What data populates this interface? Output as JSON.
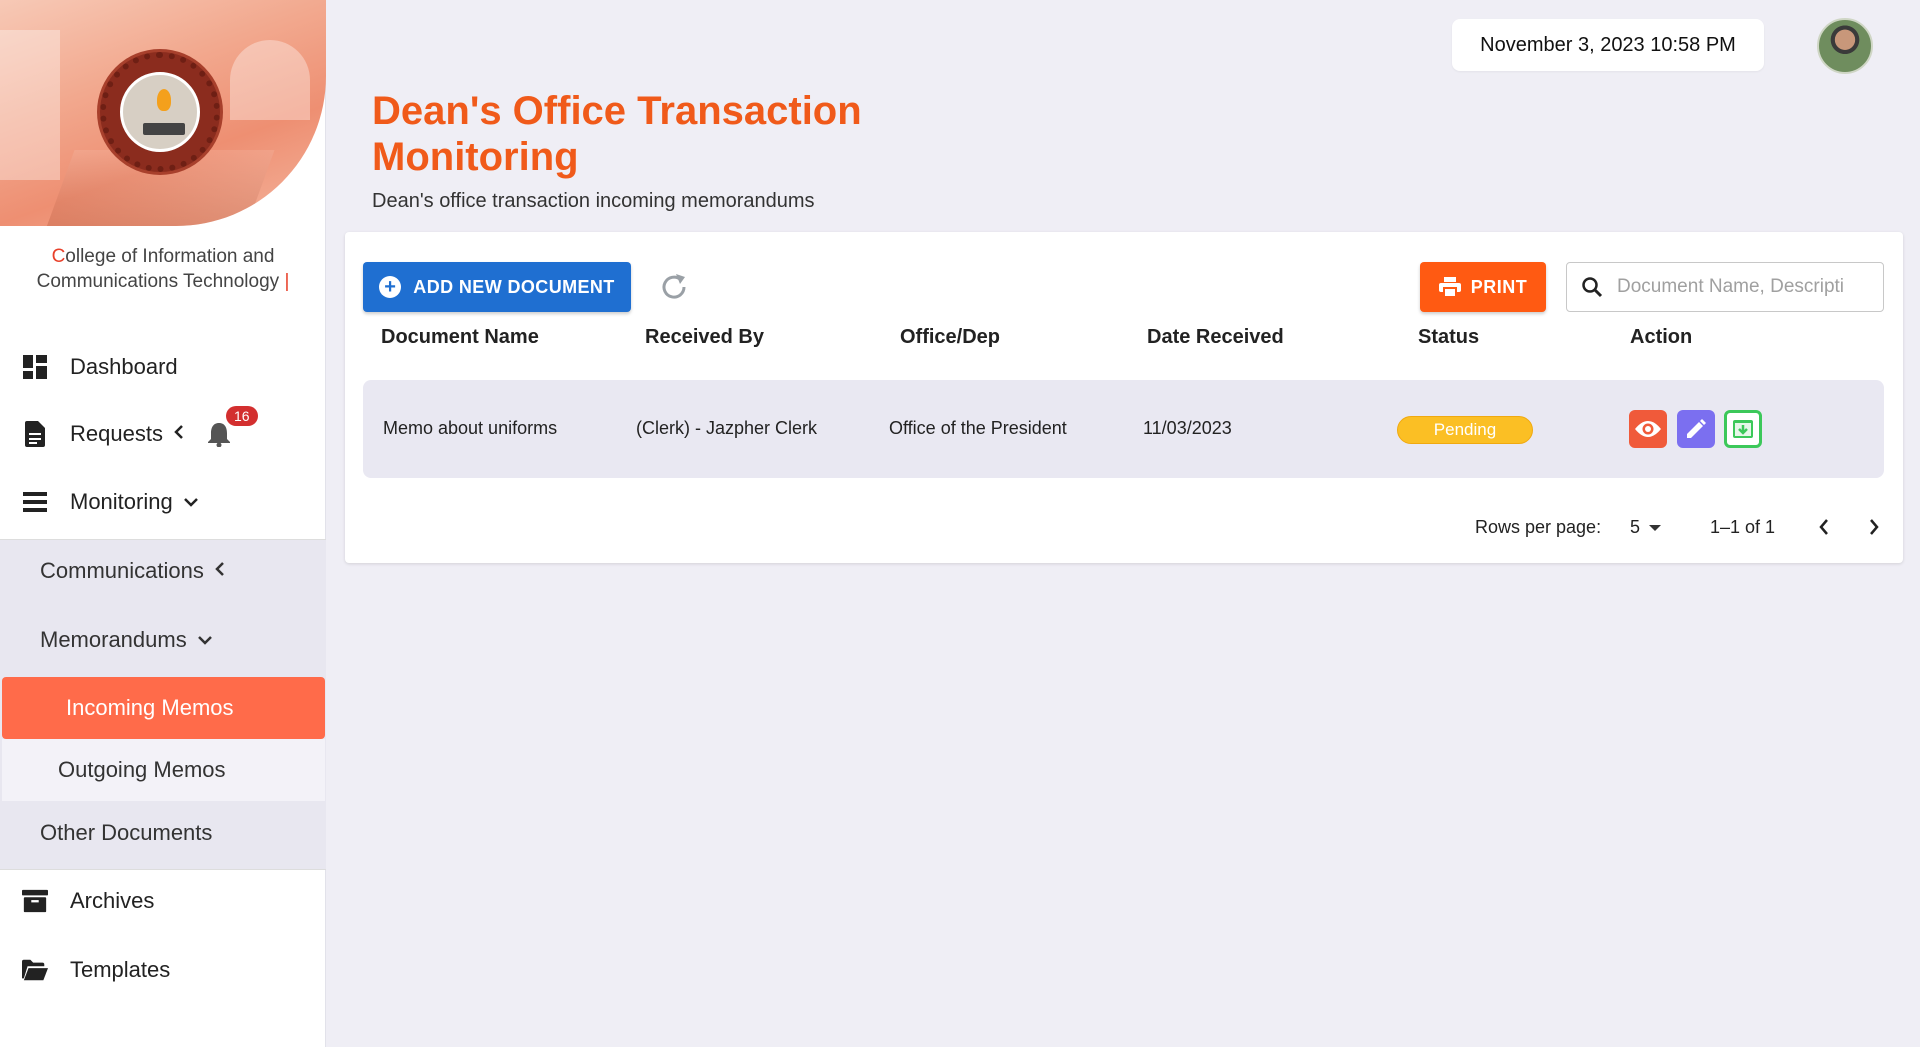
{
  "header": {
    "datetime": "November 3, 2023 10:58 PM",
    "title": "Dean's Office Transaction Monitoring",
    "subtitle": "Dean's office transaction incoming memorandums"
  },
  "sidebar": {
    "college_first_letter": "C",
    "college_rest_line1": "ollege of Information and",
    "college_line2": "Communications Technology",
    "college_bar": "|",
    "items": [
      {
        "label": "Dashboard",
        "icon": "dashboard-icon"
      },
      {
        "label": "Requests",
        "icon": "document-icon",
        "badge": "16"
      },
      {
        "label": "Monitoring",
        "icon": "list-icon"
      },
      {
        "label": "Archives",
        "icon": "archive-icon"
      },
      {
        "label": "Templates",
        "icon": "folder-open-icon"
      }
    ],
    "sub_items": {
      "communications": "Communications",
      "memorandums": "Memorandums",
      "incoming": "Incoming Memos",
      "outgoing": "Outgoing Memos",
      "other": "Other Documents"
    }
  },
  "toolbar": {
    "add_label": "ADD NEW DOCUMENT",
    "print_label": "PRINT",
    "search_placeholder": "Document Name, Descripti"
  },
  "table": {
    "columns": [
      "Document Name",
      "Received By",
      "Office/Dep",
      "Date Received",
      "Status",
      "Action"
    ],
    "rows": [
      {
        "document_name": "Memo about uniforms",
        "received_by": "(Clerk) - Jazpher Clerk",
        "office": "Office of the President",
        "date_received": "11/03/2023",
        "status": "Pending"
      }
    ]
  },
  "pagination": {
    "rows_per_page_label": "Rows per page:",
    "rows_per_page_value": "5",
    "range": "1–1 of 1"
  },
  "colors": {
    "accent": "#f05a1a",
    "active_nav": "#ff6b4a",
    "primary_button": "#1f6fd1",
    "print_button": "#ff5a12",
    "status_pending": "#fbbf24"
  }
}
